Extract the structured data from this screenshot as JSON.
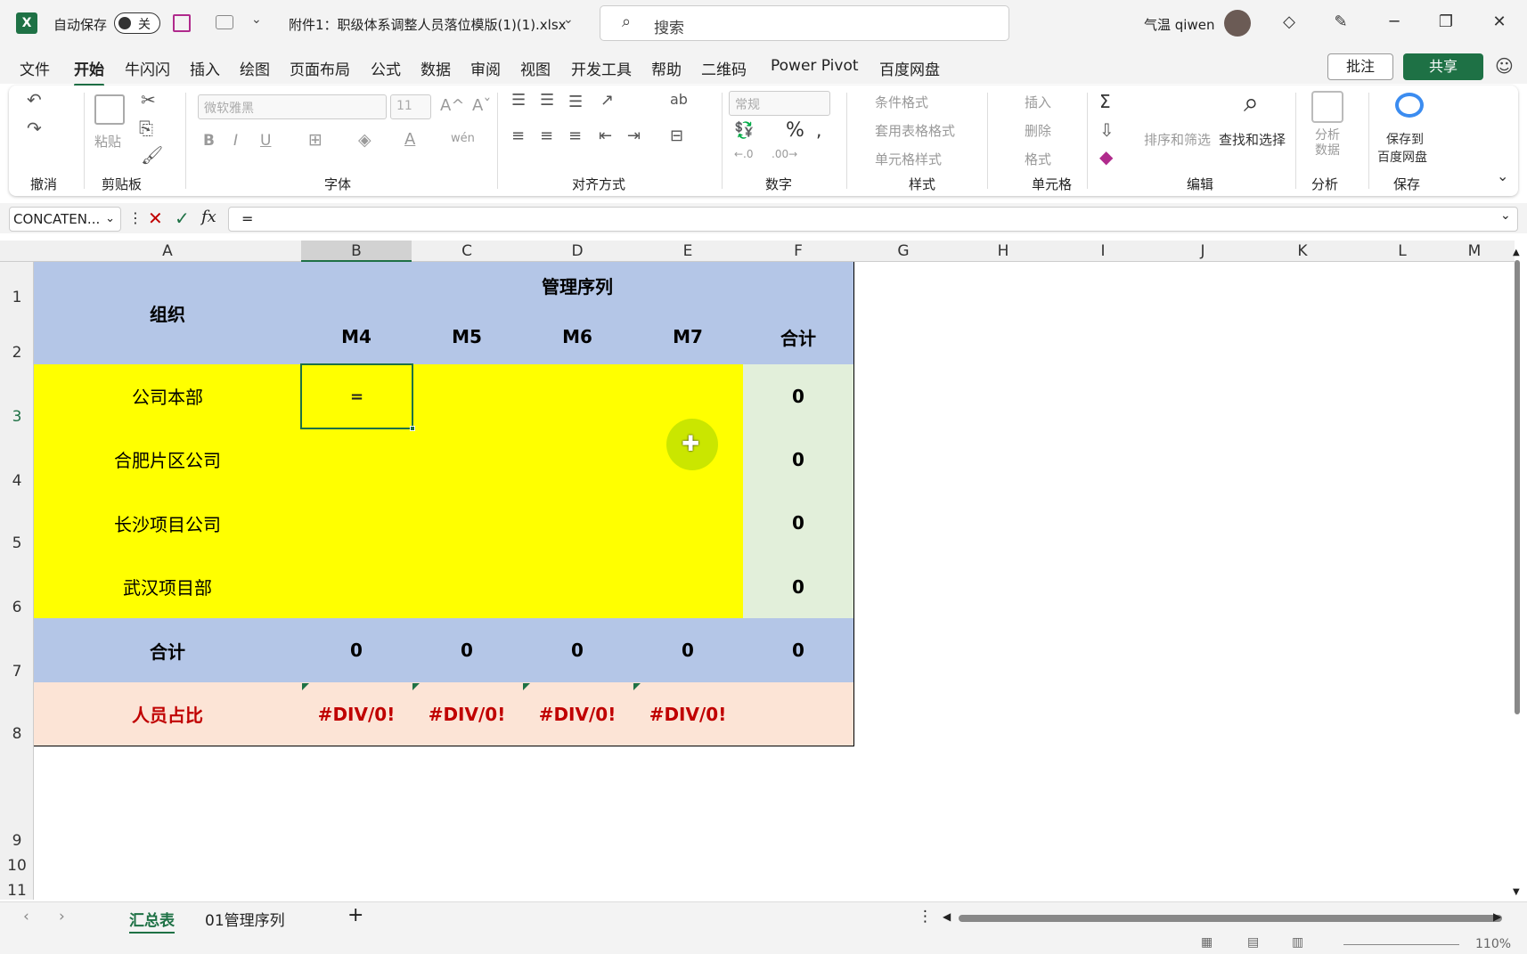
{
  "titlebar": {
    "autosave_label": "自动保存",
    "autosave_state": "关",
    "filename": "附件1：职级体系调整人员落位模版(1)(1).xlsx",
    "search_placeholder": "搜索",
    "user": "气温 qiwen"
  },
  "menu": {
    "items": [
      "文件",
      "开始",
      "牛闪闪",
      "插入",
      "绘图",
      "页面布局",
      "公式",
      "数据",
      "审阅",
      "视图",
      "开发工具",
      "帮助",
      "二维码",
      "Power Pivot",
      "百度网盘"
    ],
    "active": "开始",
    "comment": "批注",
    "share": "共享"
  },
  "ribbon": {
    "groups": [
      "撤消",
      "剪贴板",
      "字体",
      "对齐方式",
      "数字",
      "样式",
      "单元格",
      "编辑",
      "分析",
      "保存"
    ],
    "paste": "粘贴",
    "font_name": "微软雅黑",
    "font_size": "11",
    "number_format": "常规",
    "cond_format": "条件格式",
    "table_format": "套用表格格式",
    "cell_style": "单元格样式",
    "insert": "插入",
    "delete": "删除",
    "format": "格式",
    "sort_filter": "排序和筛选",
    "find_select": "查找和选择",
    "analyze": "分析数据",
    "save_baidu_1": "保存到",
    "save_baidu_2": "百度网盘"
  },
  "formula_bar": {
    "name_box": "CONCATEN...",
    "formula": "="
  },
  "columns": [
    "A",
    "B",
    "C",
    "D",
    "E",
    "F",
    "G",
    "H",
    "I",
    "J",
    "K",
    "L",
    "M"
  ],
  "rows": [
    "1",
    "2",
    "3",
    "4",
    "5",
    "6",
    "7",
    "8",
    "9",
    "10",
    "11"
  ],
  "sheet": {
    "org_header": "组织",
    "mgmt_header": "管理序列",
    "sub_headers": [
      "M4",
      "M5",
      "M6",
      "M7",
      "合计"
    ],
    "orgs": [
      "公司本部",
      "合肥片区公司",
      "长沙项目公司",
      "武汉项目部"
    ],
    "active_cell_value": "=",
    "row_totals": [
      "0",
      "0",
      "0",
      "0"
    ],
    "total_label": "合计",
    "totals": [
      "0",
      "0",
      "0",
      "0",
      "0"
    ],
    "ratio_label": "人员占比",
    "ratios": [
      "#DIV/0!",
      "#DIV/0!",
      "#DIV/0!",
      "#DIV/0!"
    ]
  },
  "tabs": {
    "active": "汇总表",
    "other": "01管理序列",
    "add": "+"
  },
  "status": {
    "zoom": "110%"
  }
}
